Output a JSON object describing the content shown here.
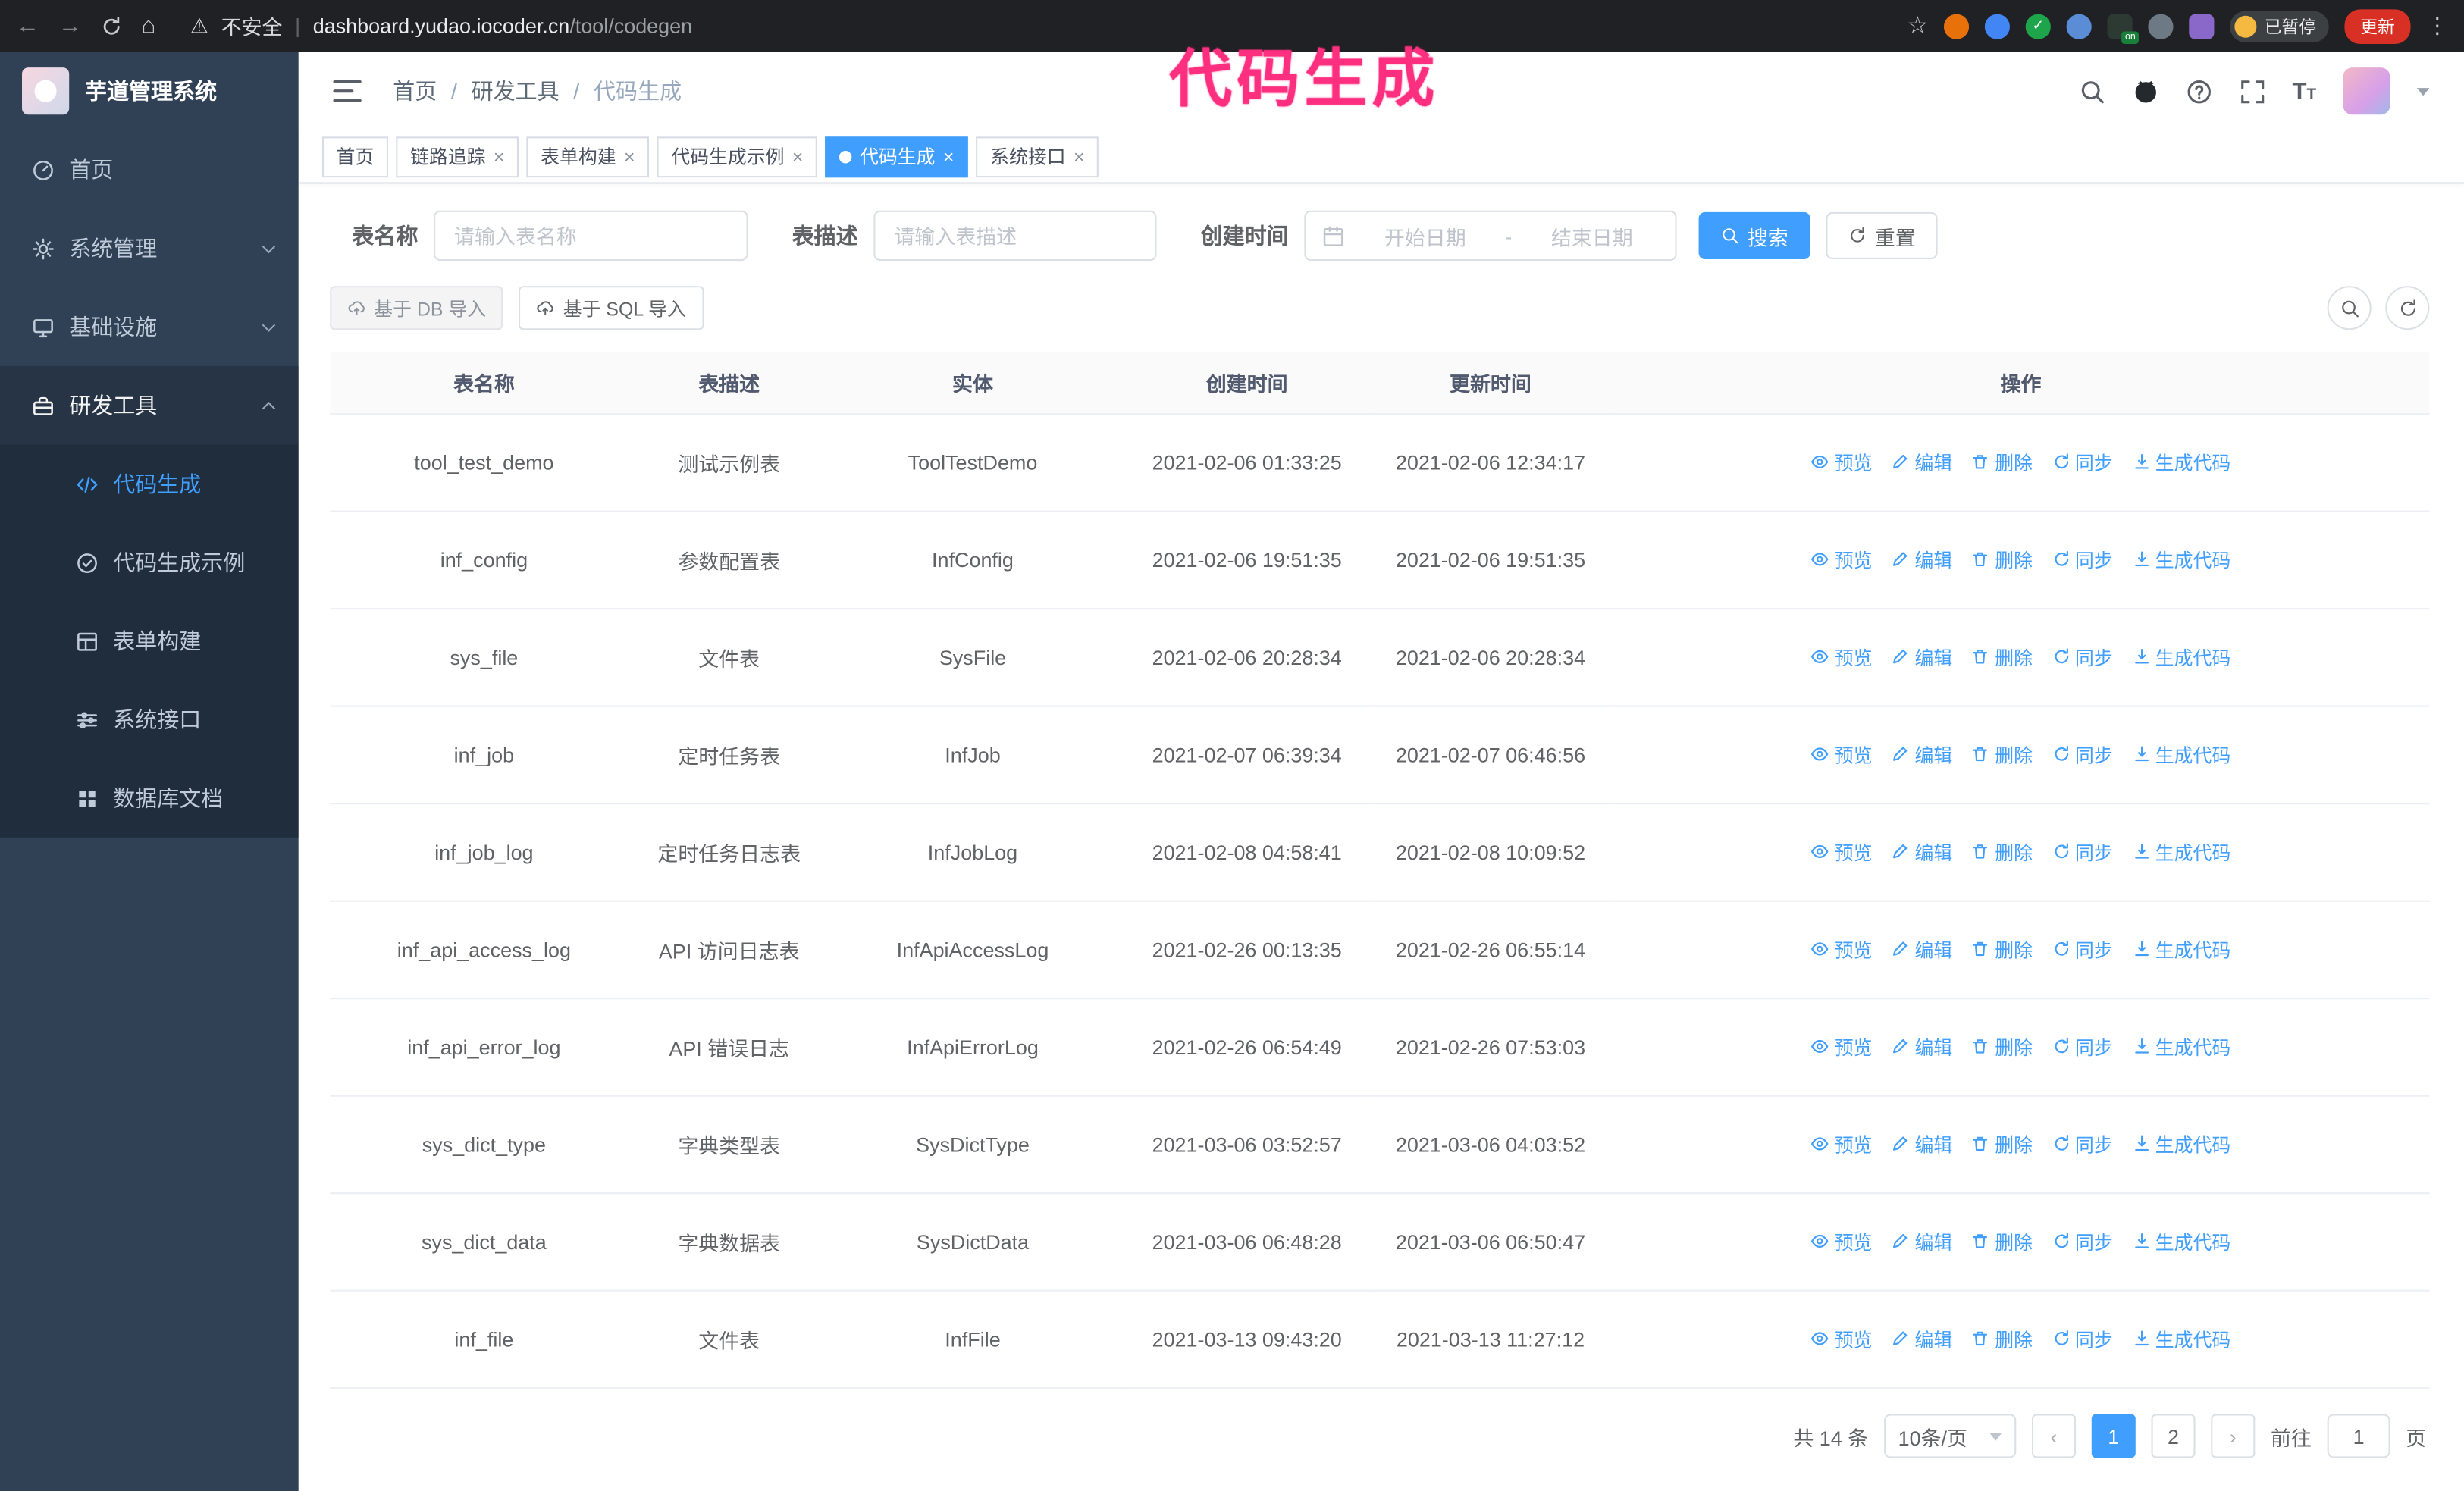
{
  "browser": {
    "security_warning": "不安全",
    "url_domain": "dashboard.yudao.iocoder.cn",
    "url_path": "/tool/codegen",
    "extension_on_badge": "on",
    "paused_badge": "已暂停",
    "update_button": "更新"
  },
  "annotation": {
    "text": "代码生成",
    "color": "#ff2f80"
  },
  "sidebar": {
    "logo_title": "芋道管理系统",
    "items": [
      {
        "label": "首页"
      },
      {
        "label": "系统管理"
      },
      {
        "label": "基础设施"
      },
      {
        "label": "研发工具"
      }
    ],
    "sub_items": [
      {
        "label": "代码生成"
      },
      {
        "label": "代码生成示例"
      },
      {
        "label": "表单构建"
      },
      {
        "label": "系统接口"
      },
      {
        "label": "数据库文档"
      }
    ]
  },
  "header": {
    "breadcrumb": [
      "首页",
      "研发工具",
      "代码生成"
    ]
  },
  "tabs": [
    {
      "label": "首页"
    },
    {
      "label": "链路追踪"
    },
    {
      "label": "表单构建"
    },
    {
      "label": "代码生成示例"
    },
    {
      "label": "代码生成"
    },
    {
      "label": "系统接口"
    }
  ],
  "filters": {
    "table_name_label": "表名称",
    "table_name_placeholder": "请输入表名称",
    "table_desc_label": "表描述",
    "table_desc_placeholder": "请输入表描述",
    "create_time_label": "创建时间",
    "start_date_placeholder": "开始日期",
    "date_separator": "-",
    "end_date_placeholder": "结束日期",
    "search_button": "搜索",
    "reset_button": "重置"
  },
  "toolbar": {
    "import_db_button": "基于 DB 导入",
    "import_sql_button": "基于 SQL 导入"
  },
  "table": {
    "columns": [
      "表名称",
      "表描述",
      "实体",
      "创建时间",
      "更新时间",
      "操作"
    ],
    "actions": [
      "预览",
      "编辑",
      "删除",
      "同步",
      "生成代码"
    ],
    "rows": [
      {
        "name": "tool_test_demo",
        "desc": "测试示例表",
        "entity": "ToolTestDemo",
        "created": "2021-02-06 01:33:25",
        "updated": "2021-02-06 12:34:17"
      },
      {
        "name": "inf_config",
        "desc": "参数配置表",
        "entity": "InfConfig",
        "created": "2021-02-06 19:51:35",
        "updated": "2021-02-06 19:51:35"
      },
      {
        "name": "sys_file",
        "desc": "文件表",
        "entity": "SysFile",
        "created": "2021-02-06 20:28:34",
        "updated": "2021-02-06 20:28:34"
      },
      {
        "name": "inf_job",
        "desc": "定时任务表",
        "entity": "InfJob",
        "created": "2021-02-07 06:39:34",
        "updated": "2021-02-07 06:46:56"
      },
      {
        "name": "inf_job_log",
        "desc": "定时任务日志表",
        "entity": "InfJobLog",
        "created": "2021-02-08 04:58:41",
        "updated": "2021-02-08 10:09:52"
      },
      {
        "name": "inf_api_access_log",
        "desc": "API 访问日志表",
        "entity": "InfApiAccessLog",
        "created": "2021-02-26 00:13:35",
        "updated": "2021-02-26 06:55:14"
      },
      {
        "name": "inf_api_error_log",
        "desc": "API 错误日志",
        "entity": "InfApiErrorLog",
        "created": "2021-02-26 06:54:49",
        "updated": "2021-02-26 07:53:03"
      },
      {
        "name": "sys_dict_type",
        "desc": "字典类型表",
        "entity": "SysDictType",
        "created": "2021-03-06 03:52:57",
        "updated": "2021-03-06 04:03:52"
      },
      {
        "name": "sys_dict_data",
        "desc": "字典数据表",
        "entity": "SysDictData",
        "created": "2021-03-06 06:48:28",
        "updated": "2021-03-06 06:50:47"
      },
      {
        "name": "inf_file",
        "desc": "文件表",
        "entity": "InfFile",
        "created": "2021-03-13 09:43:20",
        "updated": "2021-03-13 11:27:12"
      }
    ]
  },
  "pagination": {
    "total": "共 14 条",
    "page_size": "10条/页",
    "pages": [
      "1",
      "2"
    ],
    "current_page": "1",
    "goto_label": "前往",
    "goto_value": "1",
    "goto_suffix": "页"
  },
  "colors": {
    "accent": "#409eff",
    "sidebar_bg": "#304156",
    "submenu_bg": "#1f2d3d",
    "annotation": "#ff2f80"
  }
}
